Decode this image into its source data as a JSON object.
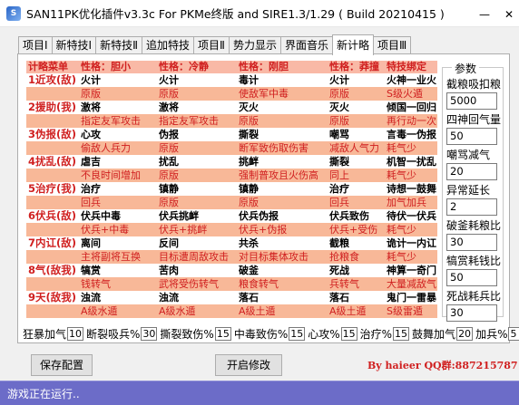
{
  "window": {
    "title": "SAN11PK优化插件v3.3c  For PKMe终版 and SIRE1.3/1.29  ( Build 20210415 )",
    "icon": "app-icon",
    "minimize": "—",
    "close": "✕"
  },
  "tabs": [
    "项目Ⅰ",
    "新特技Ⅰ",
    "新特技Ⅱ",
    "追加特技",
    "项目Ⅱ",
    "势力显示",
    "界面音乐",
    "新计略",
    "项目Ⅲ"
  ],
  "active_tab": "新计略",
  "grid": {
    "headers": [
      "计略菜单",
      "性格：胆小",
      "性格：冷静",
      "性格：刚胆",
      "性格：莽撞",
      "特技绑定"
    ],
    "rows": [
      {
        "name": "1近攻(敌)",
        "top": [
          "火计",
          "火计",
          "毒计",
          "火计",
          "火神一业火"
        ],
        "bottom": [
          "原版",
          "原版",
          "使敌军中毒",
          "原版",
          "S级火遁"
        ]
      },
      {
        "name": "2援助(我)",
        "top": [
          "激将",
          "激将",
          "灭火",
          "灭火",
          "倾国一回归"
        ],
        "bottom": [
          "指定友军攻击",
          "指定友军攻击",
          "原版",
          "原版",
          "再行动一次"
        ]
      },
      {
        "name": "3伪报(敌)",
        "top": [
          "心攻",
          "伪报",
          "撕裂",
          "嘲骂",
          "言毒一伪报"
        ],
        "bottom": [
          "偷敌人兵力",
          "原版",
          "断军致伤取伤害",
          "减敌人气力",
          "耗气少"
        ]
      },
      {
        "name": "4扰乱(敌)",
        "top": [
          "虐吉",
          "扰乱",
          "挑衅",
          "撕裂",
          "机智一扰乱"
        ],
        "bottom": [
          "不良时间增加",
          "原版",
          "强制普攻且火伤高",
          "同上",
          "耗气少"
        ]
      },
      {
        "name": "5治疗(我)",
        "top": [
          "治疗",
          "镇静",
          "镇静",
          "治疗",
          "诗想一鼓舞"
        ],
        "bottom": [
          "回兵",
          "原版",
          "原版",
          "回兵",
          "加气加兵"
        ]
      },
      {
        "name": "6伏兵(敌)",
        "top": [
          "伏兵中毒",
          "伏兵挑衅",
          "伏兵伪报",
          "伏兵致伤",
          "待伏一伏兵"
        ],
        "bottom": [
          "伏兵+中毒",
          "伏兵+挑衅",
          "伏兵+伪报",
          "伏兵+受伤",
          "耗气少"
        ]
      },
      {
        "name": "7内讧(敌)",
        "top": [
          "离间",
          "反间",
          "共杀",
          "截粮",
          "诡计一内讧"
        ],
        "bottom": [
          "主将副将互换",
          "目标遭周敌攻击",
          "对目标集体攻击",
          "抢粮食",
          "耗气少"
        ]
      },
      {
        "name": "8气(敌我)",
        "top": [
          "犒赏",
          "苦肉",
          "破釜",
          "死战",
          "神算一奇门"
        ],
        "bottom": [
          "钱转气",
          "武将受伤转气",
          "粮食转气",
          "兵转气",
          "大量减敌气"
        ]
      },
      {
        "name": "9天(敌我)",
        "top": [
          "浊流",
          "浊流",
          "落石",
          "落石",
          "鬼门一雷暴"
        ],
        "bottom": [
          "A级水遁",
          "A级水遁",
          "A级土遁",
          "A级土遁",
          "S级雷遁"
        ]
      }
    ]
  },
  "params": {
    "title": "参数",
    "items": [
      {
        "label": "截粮吸扣粮",
        "value": "5000"
      },
      {
        "label": "四神回气量",
        "value": "50"
      },
      {
        "label": "嘲骂减气",
        "value": "20"
      },
      {
        "label": "异常延长",
        "value": "2"
      },
      {
        "label": "破釜耗粮比",
        "value": "30"
      },
      {
        "label": "犒赏耗钱比",
        "value": "50"
      },
      {
        "label": "死战耗兵比",
        "value": "30"
      }
    ]
  },
  "bottom_params": [
    {
      "label": "狂暴加气",
      "value": "10"
    },
    {
      "label": "断裂吸兵%",
      "value": "30"
    },
    {
      "label": "撕裂致伤%",
      "value": "15"
    },
    {
      "label": "中毒致伤%",
      "value": "15"
    },
    {
      "label": "心攻%",
      "value": "15"
    },
    {
      "label": "治疗%",
      "value": "15"
    },
    {
      "label": "鼓舞加气",
      "value": "20"
    },
    {
      "label": "加兵%",
      "value": "5"
    }
  ],
  "buttons": {
    "save": "保存配置",
    "start": "开启修改"
  },
  "credit": "By haieer  QQ群:887215787",
  "status": "游戏正在运行.."
}
